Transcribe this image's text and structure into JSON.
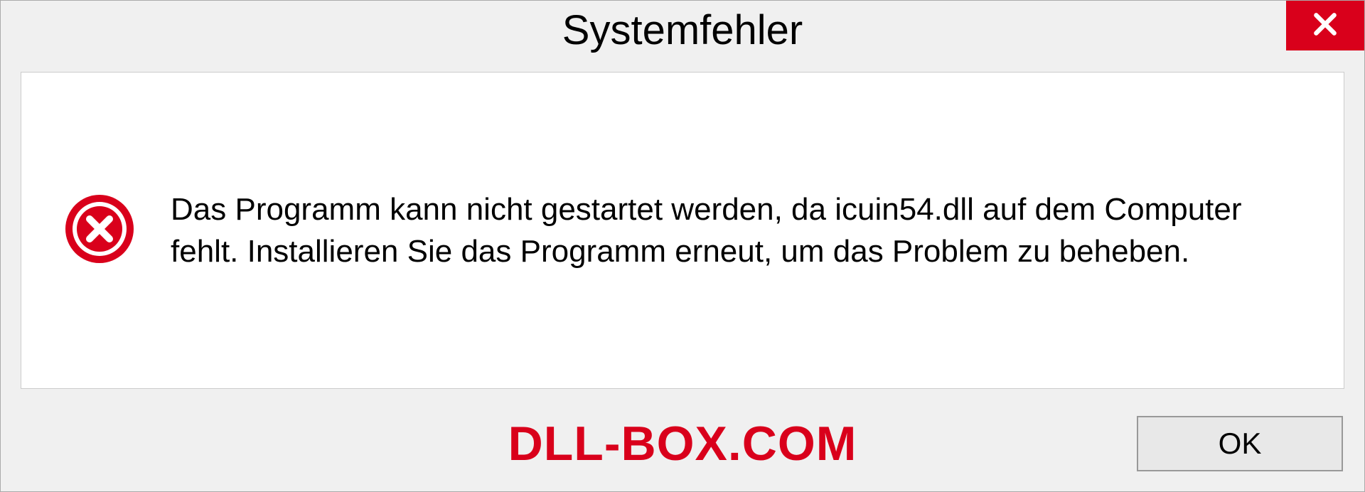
{
  "dialog": {
    "title": "Systemfehler",
    "message": "Das Programm kann nicht gestartet werden, da icuin54.dll auf dem Computer fehlt. Installieren Sie das Programm erneut, um das Problem zu beheben.",
    "ok_label": "OK"
  },
  "watermark": "DLL-BOX.COM"
}
